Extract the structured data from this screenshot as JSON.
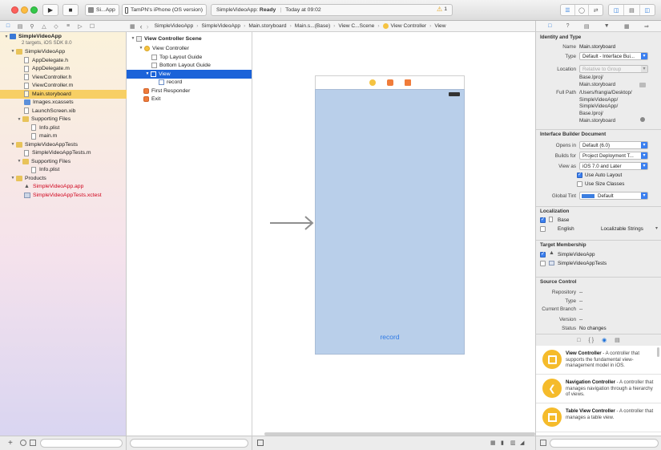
{
  "toolbar": {
    "scheme": "Si...App",
    "device": "TamPN's iPhone (OS version)",
    "status_app": "SimpleVideoApp:",
    "status_state": "Ready",
    "status_time": "Today at 09:02",
    "warning_count": "1"
  },
  "navigator": {
    "project": "SimpleVideoApp",
    "project_sub": "2 targets, iOS SDK 8.0",
    "items": [
      {
        "label": "SimpleVideoApp"
      },
      {
        "label": "AppDelegate.h"
      },
      {
        "label": "AppDelegate.m"
      },
      {
        "label": "ViewController.h"
      },
      {
        "label": "ViewController.m"
      },
      {
        "label": "Main.storyboard"
      },
      {
        "label": "Images.xcassets"
      },
      {
        "label": "LaunchScreen.xib"
      },
      {
        "label": "Supporting Files"
      },
      {
        "label": "Info.plist"
      },
      {
        "label": "main.m"
      },
      {
        "label": "SimpleVideoAppTests"
      },
      {
        "label": "SimpleVideoAppTests.m"
      },
      {
        "label": "Supporting Files"
      },
      {
        "label": "Info.plist"
      },
      {
        "label": "Products"
      },
      {
        "label": "SimpleVideoApp.app"
      },
      {
        "label": "SimpleVideoAppTests.xctest"
      }
    ]
  },
  "jumpbar": {
    "crumbs": [
      "SimpleVideoApp",
      "SimpleVideoApp",
      "Main.storyboard",
      "Main.s...(Base)",
      "View C...Scene",
      "View Controller",
      "View"
    ]
  },
  "outline": {
    "items": [
      {
        "label": "View Controller Scene"
      },
      {
        "label": "View Controller"
      },
      {
        "label": "Top Layout Guide"
      },
      {
        "label": "Bottom Layout Guide"
      },
      {
        "label": "View"
      },
      {
        "label": "record"
      },
      {
        "label": "First Responder"
      },
      {
        "label": "Exit"
      }
    ]
  },
  "canvas": {
    "button_title": "record"
  },
  "inspector": {
    "identity_title": "Identity and Type",
    "name_label": "Name",
    "name_value": "Main.storyboard",
    "type_label": "Type",
    "type_value": "Default - Interface Bui...",
    "location_label": "Location",
    "location_value": "Relative to Group",
    "location_path_1": "Base.lproj/",
    "location_path_2": "Main.storyboard",
    "fullpath_label": "Full Path",
    "fullpath_1": "/Users/frangia/Desktop/",
    "fullpath_2": "SimpleVideoApp/",
    "fullpath_3": "SimpleVideoApp/",
    "fullpath_4": "Base.lproj/",
    "fullpath_5": "Main.storyboard",
    "ibdoc_title": "Interface Builder Document",
    "opens_label": "Opens in",
    "opens_value": "Default (6.0)",
    "builds_label": "Builds for",
    "builds_value": "Project Deployment T...",
    "viewas_label": "View as",
    "viewas_value": "iOS 7.0 and Later",
    "autolayout_label": "Use Auto Layout",
    "sizeclasses_label": "Use Size Classes",
    "tint_label": "Global Tint",
    "tint_value": "Default",
    "tint_color": "#3b7ee0",
    "localization_title": "Localization",
    "loc_base": "Base",
    "loc_english": "English",
    "loc_english_value": "Localizable Strings",
    "membership_title": "Target Membership",
    "member_1": "SimpleVideoApp",
    "member_2": "SimpleVideoAppTests",
    "source_title": "Source Control",
    "repo_label": "Repository",
    "repo_value": "--",
    "sc_type_label": "Type",
    "sc_type_value": "--",
    "branch_label": "Current Branch",
    "branch_value": "--",
    "version_label": "Version",
    "version_value": "--",
    "status_label": "Status",
    "status_value": "No changes"
  },
  "library": {
    "items": [
      {
        "title": "View Controller",
        "desc": " - A controller that supports the fundamental view-management model in iOS."
      },
      {
        "title": "Navigation Controller",
        "desc": " - A controller that manages navigation through a hierarchy of views."
      },
      {
        "title": "Table View Controller",
        "desc": " - A controller that manages a table view."
      }
    ]
  },
  "colors": {
    "selection_yellow": "#f7cf64",
    "selection_blue": "#1b63d9",
    "view_background": "#b9cfea",
    "accent": "#2f7ae5"
  }
}
